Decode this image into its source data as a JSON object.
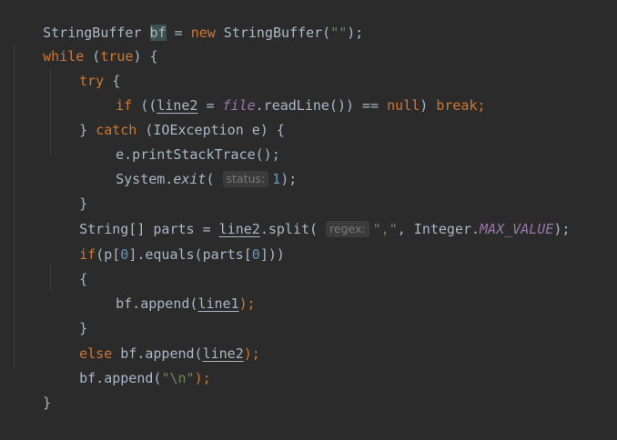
{
  "code": {
    "l1": {
      "a": "StringBuffer ",
      "b": "bf",
      "c": " = ",
      "d": "new",
      "e": " StringBuffer(",
      "f": "\"\"",
      "g": ");"
    },
    "l2": {
      "a": "while",
      "b": " (",
      "c": "true",
      "d": ") {"
    },
    "l3": {
      "a": "try",
      "b": " {"
    },
    "l4": {
      "a": "if",
      "b": " ((",
      "c": "line2",
      "d": " = ",
      "e": "file",
      "f": ".readLine()) == ",
      "g": "null",
      "h": ") ",
      "i": "break",
      ";": ";"
    },
    "l5": {
      "a": "} ",
      "b": "catch",
      "c": " (IOException e) {"
    },
    "l6": {
      "a": "e.printStackTrace();"
    },
    "l7": {
      "a": "System.",
      "b": "exit",
      "c": "( ",
      "hint": "status:",
      "d": "1",
      "e": ");"
    },
    "l8": {
      "a": "}"
    },
    "l9": {
      "a": "String[] parts = ",
      "b": "line2",
      "c": ".split( ",
      "hint": "regex:",
      "d": "\",\"",
      "e": ", Integer.",
      "f": "MAX_VALUE",
      "g": ");"
    },
    "l10": {
      "a": "if",
      "b": "(p[",
      "c": "0",
      "d": "].equals(parts[",
      "e": "0",
      "f": "]))"
    },
    "l11": {
      "a": "{"
    },
    "l12": {
      "a": "bf.append(",
      "b": "line1",
      "c": ");"
    },
    "l13": {
      "a": "}"
    },
    "l14": {
      "a": "else",
      "b": " bf.append(",
      "c": "line2",
      "d": ");"
    },
    "l15": {
      "a": "bf.append(",
      "b": "\"\\n\"",
      "c": ");"
    },
    "l16": {
      "a": "}"
    }
  }
}
